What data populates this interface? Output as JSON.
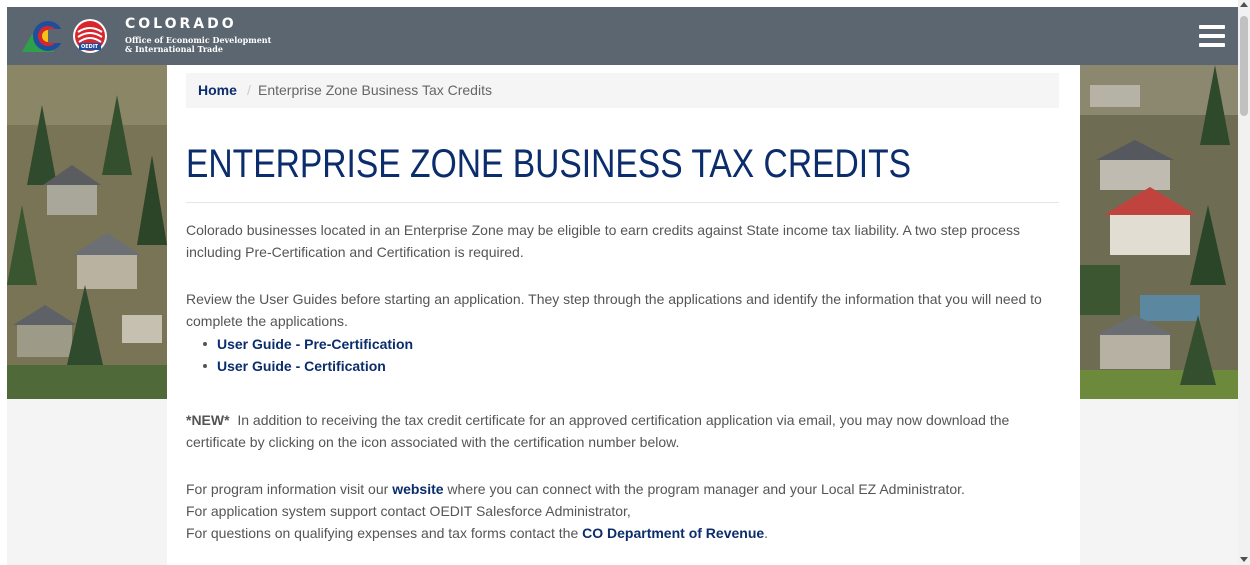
{
  "header": {
    "brand_title": "COLORADO",
    "brand_line1": "Office of Economic Development",
    "brand_line2": "& International Trade",
    "logo_badge": "OEDIT",
    "menu_icon": "hamburger-menu-icon"
  },
  "breadcrumb": {
    "home": "Home",
    "separator": "/",
    "current": "Enterprise Zone Business Tax Credits"
  },
  "page": {
    "title": "ENTERPRISE ZONE BUSINESS TAX CREDITS",
    "intro_line1": "Colorado businesses located in an Enterprise Zone may be eligible to earn credits against State income tax liability. A two step process",
    "intro_line2": "including Pre-Certification and Certification is required.",
    "review_line1": "Review the User Guides before starting an application. They step through the applications and identify the information that you will need to",
    "review_line2": "complete the applications.",
    "guides": [
      {
        "label": "User Guide - Pre-Certification"
      },
      {
        "label": "User Guide - Certification"
      }
    ],
    "new_tag": "*NEW*",
    "new_line1": "  In addition to receiving the tax credit certificate for an approved certification application via email, you may now download the",
    "new_line2": "certificate by clicking on the icon associated with the certification number below.",
    "info1_pre": "For program information visit our ",
    "info1_link": "website",
    "info1_post": " where you can connect with the program manager and your Local EZ Administrator.",
    "info2": "For application system support contact OEDIT Salesforce Administrator,",
    "info3_pre": "For questions on qualifying expenses and tax forms contact the ",
    "info3_link": "CO Department of Revenue",
    "info3_post": "."
  },
  "colors": {
    "header_bg": "#5c6670",
    "title_blue": "#0b2d6b",
    "link_blue": "#0b2d6b",
    "text_gray": "#555555",
    "logo_red": "#d8262c",
    "logo_blue": "#1f4f9c",
    "logo_green": "#2e9f4a",
    "logo_yellow": "#f3c316"
  }
}
